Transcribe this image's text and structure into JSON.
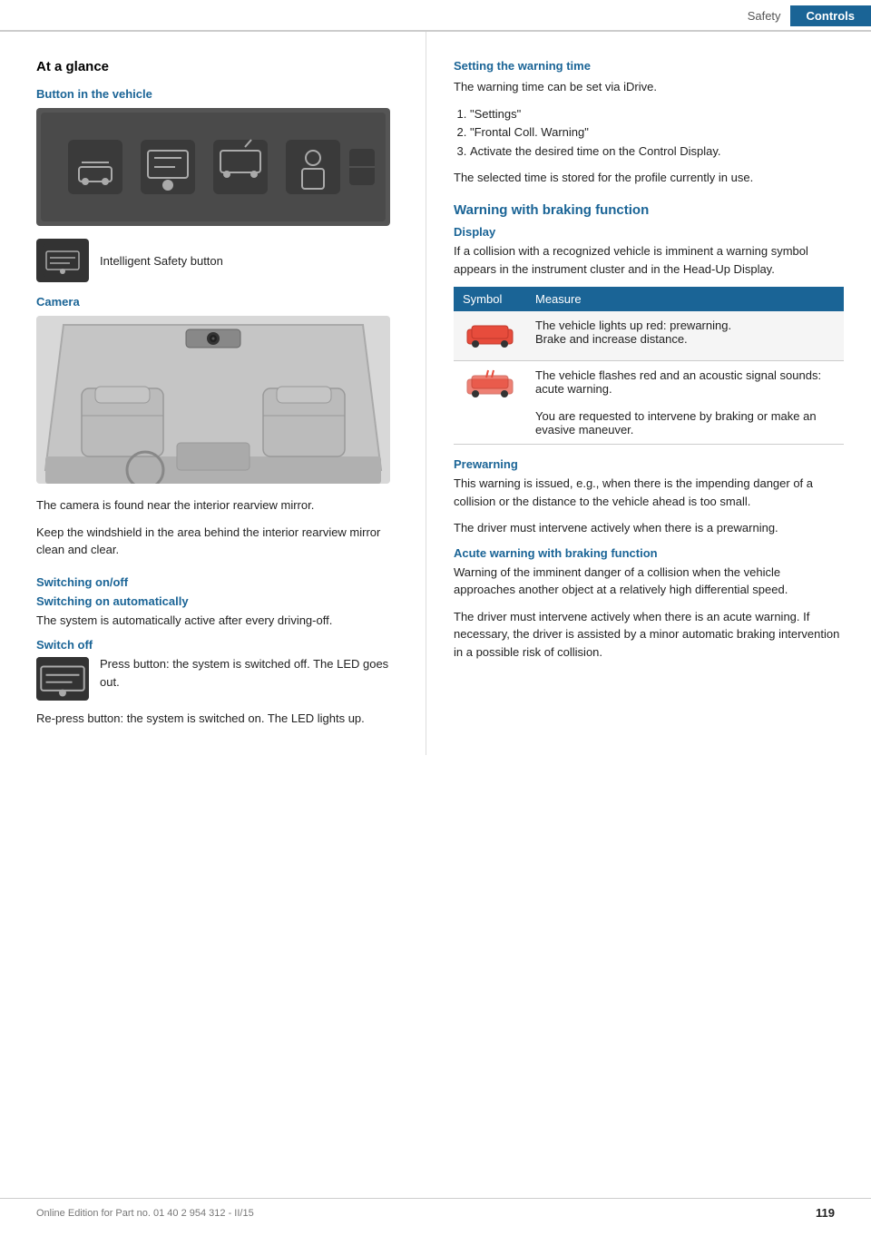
{
  "header": {
    "safety_label": "Safety",
    "controls_label": "Controls"
  },
  "left": {
    "at_a_glance": "At a glance",
    "button_in_vehicle": "Button in the vehicle",
    "isb_label": "Intelligent Safety button",
    "camera_label": "Camera",
    "camera_body_1": "The camera is found near the interior rearview mirror.",
    "camera_body_2": "Keep the windshield in the area behind the interior rearview mirror clean and clear.",
    "switching_title": "Switching on/off",
    "switching_on_auto_title": "Switching on automatically",
    "switching_on_auto_body": "The system is automatically active after every driving-off.",
    "switch_off_title": "Switch off",
    "switch_off_body": "Press button: the system is switched off. The LED goes out.",
    "re_press_body": "Re-press button: the system is switched on. The LED lights up."
  },
  "right": {
    "setting_warning_title": "Setting the warning time",
    "setting_warning_intro": "The warning time can be set via iDrive.",
    "steps": [
      {
        "num": "1.",
        "text": "\"Settings\""
      },
      {
        "num": "2.",
        "text": "\"Frontal Coll. Warning\""
      },
      {
        "num": "3.",
        "text": "Activate the desired time on the Control Display."
      }
    ],
    "setting_warning_footer": "The selected time is stored for the profile currently in use.",
    "warning_braking_title": "Warning with braking function",
    "display_title": "Display",
    "display_body": "If a collision with a recognized vehicle is imminent a warning symbol appears in the instrument cluster and in the Head-Up Display.",
    "table_header": {
      "symbol": "Symbol",
      "measure": "Measure"
    },
    "table_rows": [
      {
        "symbol_alt": "car-prewarning",
        "measure_1": "The vehicle lights up red: prewarning.",
        "measure_2": "Brake and increase distance."
      },
      {
        "symbol_alt": "car-acute-warning",
        "measure_1": "The vehicle flashes red and an acoustic signal sounds: acute warning.",
        "measure_2": "You are requested to intervene by braking or make an evasive maneuver."
      }
    ],
    "prewarning_title": "Prewarning",
    "prewarning_body_1": "This warning is issued, e.g., when there is the impending danger of a collision or the distance to the vehicle ahead is too small.",
    "prewarning_body_2": "The driver must intervene actively when there is a prewarning.",
    "acute_title": "Acute warning with braking function",
    "acute_body_1": "Warning of the imminent danger of a collision when the vehicle approaches another object at a relatively high differential speed.",
    "acute_body_2": "The driver must intervene actively when there is an acute warning. If necessary, the driver is assisted by a minor automatic braking intervention in a possible risk of collision."
  },
  "footer": {
    "text": "Online Edition for Part no. 01 40 2 954 312 - II/15",
    "page": "119"
  }
}
